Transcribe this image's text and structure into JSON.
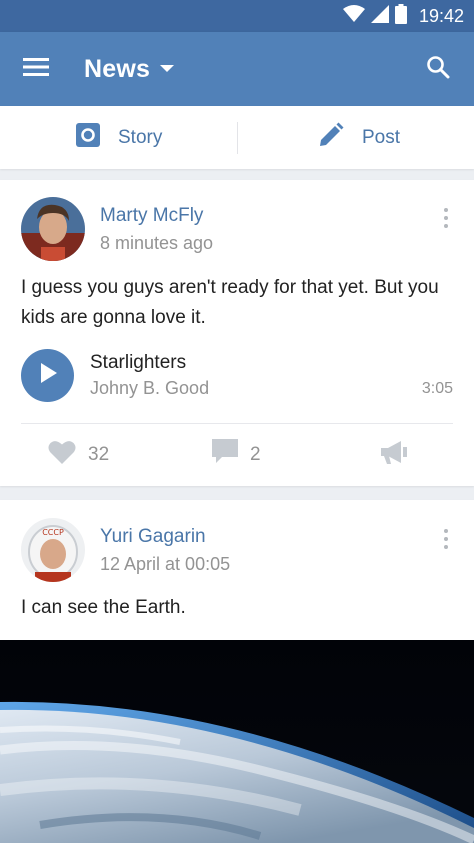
{
  "status_bar": {
    "time": "19:42"
  },
  "header": {
    "title": "News"
  },
  "composer": {
    "story_label": "Story",
    "post_label": "Post"
  },
  "posts": [
    {
      "author": "Marty McFly",
      "time": "8 minutes ago",
      "text": "I guess you guys aren't ready for that yet. But you kids are gonna love it.",
      "audio": {
        "title": "Starlighters",
        "artist": "Johny B. Good",
        "duration": "3:05"
      },
      "likes": "32",
      "comments": "2"
    },
    {
      "author": "Yuri Gagarin",
      "time": "12 April at 00:05",
      "text": "I can see the Earth."
    }
  ],
  "colors": {
    "primary": "#5181b8",
    "status_bar": "#3e68a0",
    "link": "#4a76a8",
    "secondary_text": "#939393"
  }
}
